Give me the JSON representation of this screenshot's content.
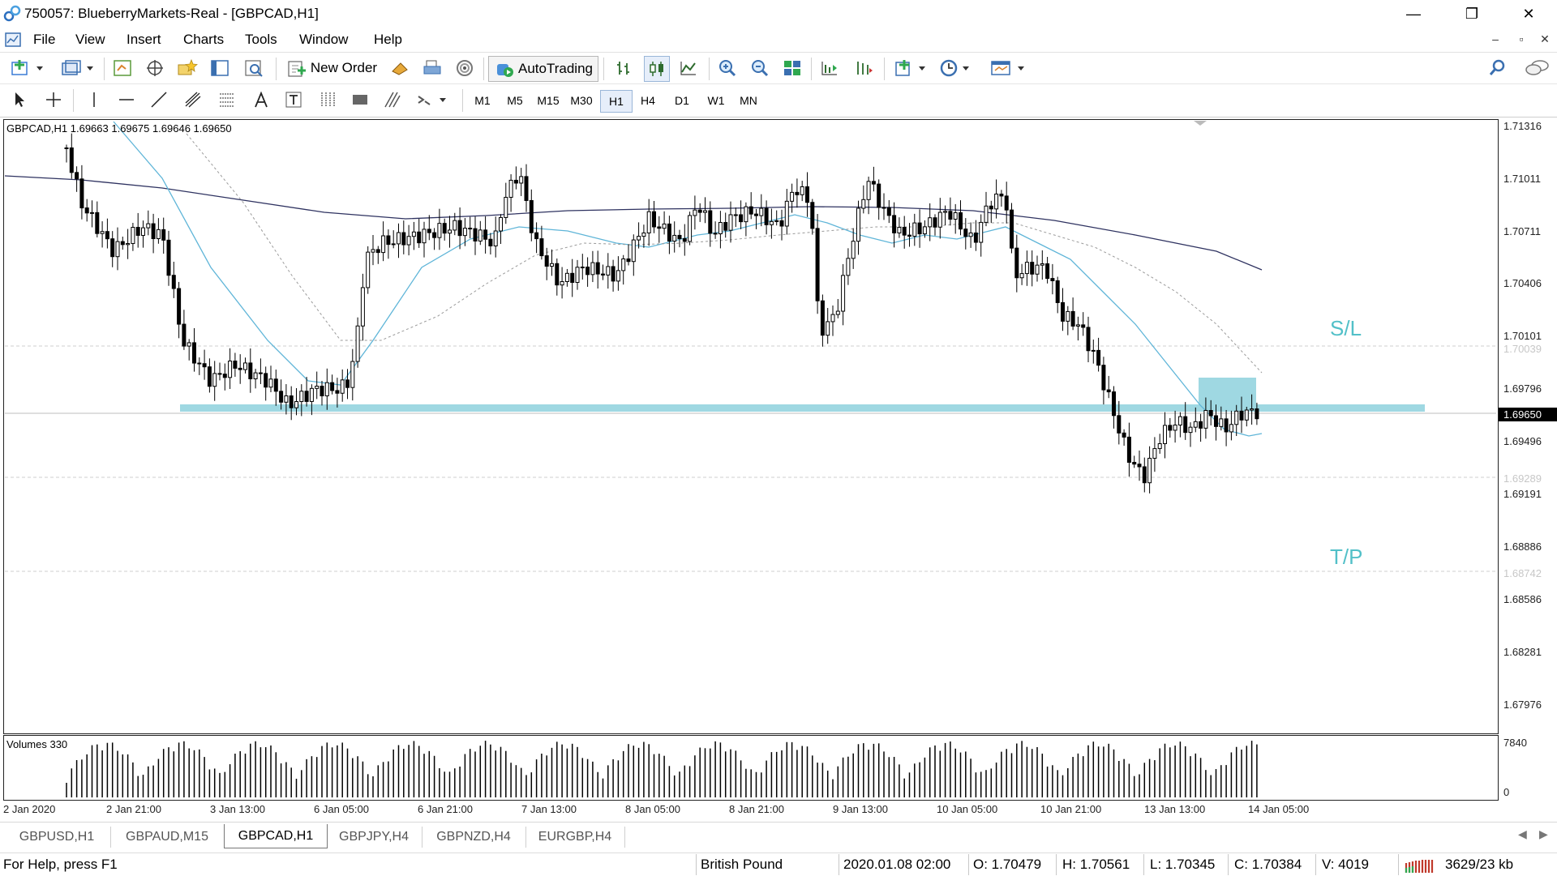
{
  "window": {
    "title": "750057: BlueberryMarkets-Real - [GBPCAD,H1]",
    "controls": {
      "minimize": "—",
      "restore": "❐",
      "close": "✕"
    }
  },
  "menu": [
    "File",
    "View",
    "Insert",
    "Charts",
    "Tools",
    "Window",
    "Help"
  ],
  "mdi_controls": {
    "minimize": "‒",
    "restore": "▫",
    "close": "✕"
  },
  "toolbar": {
    "new_order": "New Order",
    "autotrading": "AutoTrading",
    "icons": [
      "new-chart-icon",
      "profiles-icon",
      "market-watch-icon",
      "navigator-icon",
      "favorites-icon",
      "data-window-icon",
      "strategy-tester-icon",
      "new-order-icon",
      "metaeditor-icon",
      "print-icon",
      "signals-icon",
      "autotrading-icon",
      "bar-chart-icon",
      "candlestick-icon",
      "line-chart-icon",
      "zoom-in-icon",
      "zoom-out-icon",
      "tile-windows-icon",
      "chart-shift-icon",
      "autoscroll-icon",
      "indicators-icon",
      "periods-icon",
      "templates-icon",
      "search-icon",
      "chat-icon"
    ]
  },
  "drawing_tools": [
    "cursor-icon",
    "crosshair-icon",
    "vertical-line-icon",
    "horizontal-line-icon",
    "trendline-icon",
    "equidistant-channel-icon",
    "fibonacci-icon",
    "text-icon",
    "text-label-icon",
    "fibo-fan-icon",
    "rectangle-icon",
    "hatch-icon",
    "arrows-icon"
  ],
  "periods": [
    "M1",
    "M5",
    "M15",
    "M30",
    "H1",
    "H4",
    "D1",
    "W1",
    "MN"
  ],
  "active_period": "H1",
  "chart": {
    "info": "GBPCAD,H1  1.69663 1.69675 1.69646 1.69650",
    "volumes_label": "Volumes 330",
    "current_price": "1.69650",
    "sl_label": "S/L",
    "tp_label": "T/P"
  },
  "chart_data": {
    "type": "candlestick",
    "symbol": "GBPCAD",
    "timeframe": "H1",
    "price_axis": [
      "1.71316",
      "1.71011",
      "1.70711",
      "1.70406",
      "1.70101",
      "1.69796",
      "1.69496",
      "1.69191",
      "1.68886",
      "1.68586",
      "1.68281",
      "1.67976"
    ],
    "level_labels": {
      "sl": "1.70039",
      "tp": "1.68742",
      "entry_zone_low": "1.69289"
    },
    "volume_axis": [
      "7840",
      "0"
    ],
    "time_axis": [
      "2 Jan 2020",
      "2 Jan 21:00",
      "3 Jan 13:00",
      "6 Jan 05:00",
      "6 Jan 21:00",
      "7 Jan 13:00",
      "8 Jan 05:00",
      "8 Jan 21:00",
      "9 Jan 13:00",
      "10 Jan 05:00",
      "10 Jan 21:00",
      "13 Jan 13:00",
      "14 Jan 05:00"
    ],
    "ohlc": {
      "open": 1.69663,
      "high": 1.69675,
      "low": 1.69646,
      "close": 1.6965
    },
    "indicators": [
      "moving-average-fast",
      "moving-average-slow",
      "moving-average-dotted"
    ],
    "colors": {
      "fast_ma": "#5fb5d8",
      "slow_ma": "#2e3260",
      "dotted_ma": "#9a9a9a",
      "support_zone": "#9fd8e2",
      "annotation": "#52c0c8"
    }
  },
  "tabs": [
    "GBPUSD,H1",
    "GBPAUD,M15",
    "GBPCAD,H1",
    "GBPJPY,H4",
    "GBPNZD,H4",
    "EURGBP,H4"
  ],
  "active_tab": "GBPCAD,H1",
  "tab_nav": {
    "left": "◀",
    "right": "▶"
  },
  "status": {
    "help": "For Help, press F1",
    "description": "British Pound",
    "datetime": "2020.01.08 02:00",
    "open": "O: 1.70479",
    "high": "H: 1.70561",
    "low": "L: 1.70345",
    "close": "C: 1.70384",
    "volume": "V: 4019",
    "traffic": "3629/23 kb"
  }
}
